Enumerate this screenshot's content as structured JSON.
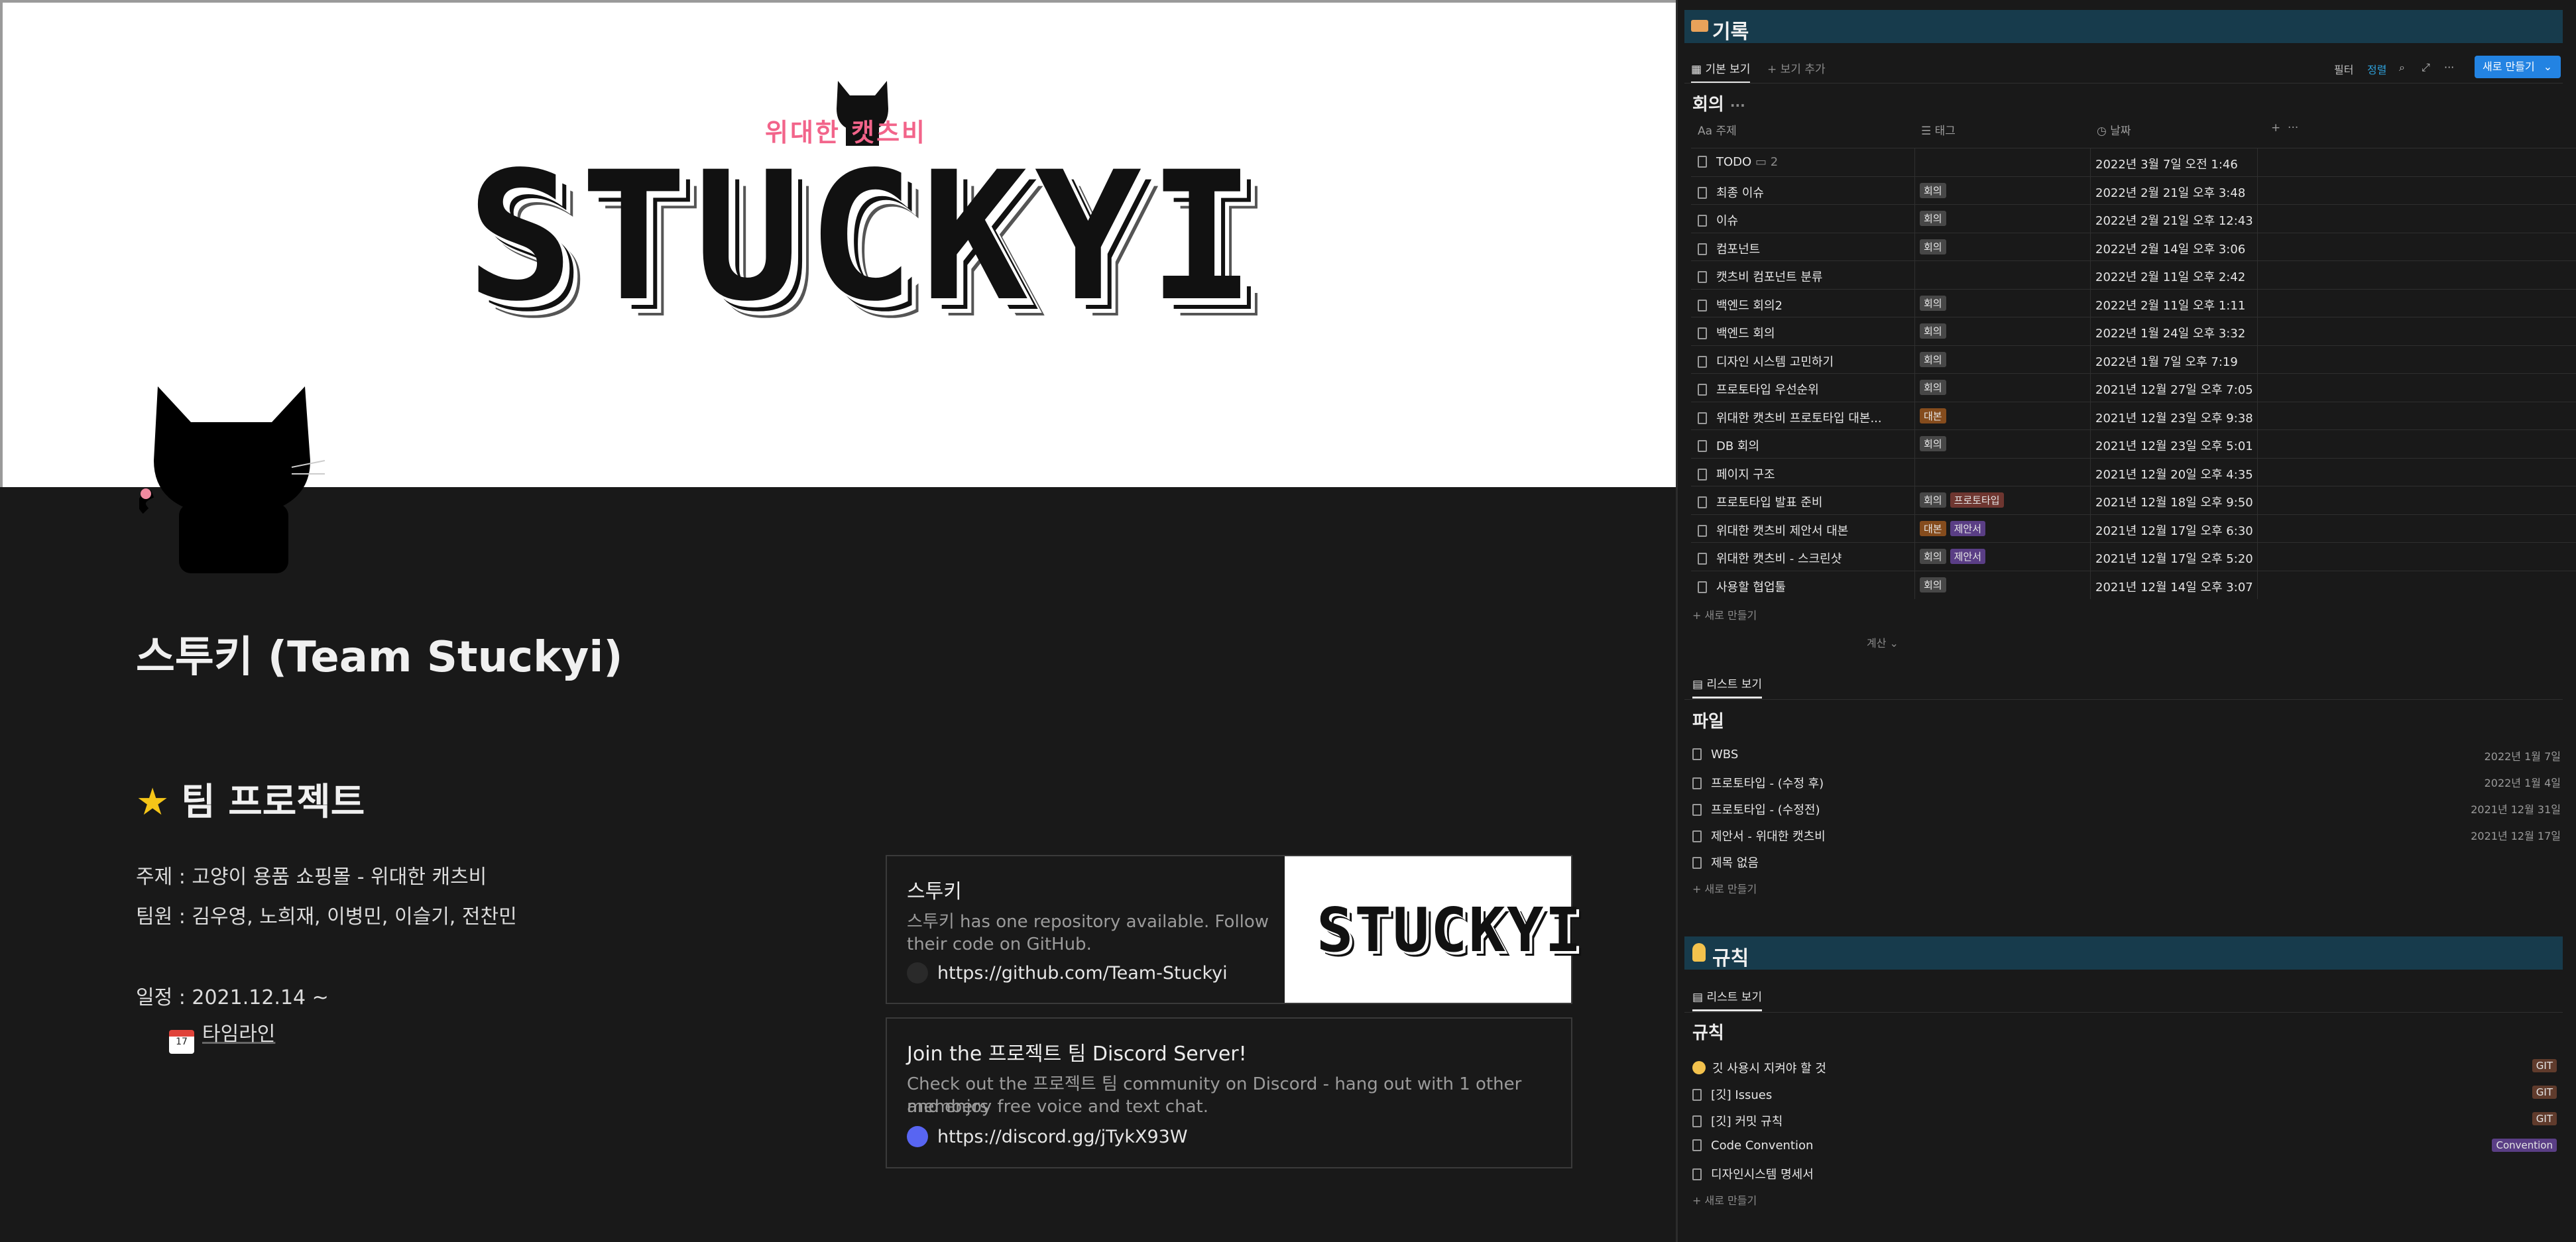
{
  "left": {
    "banner": {
      "logo_small": "위대한 캣츠비",
      "logo_big": "STUCKYI"
    },
    "title": "스투키 (Team Stuckyi)",
    "section_title": "팀 프로젝트",
    "subject": "주제 :  고양이 용품 쇼핑몰 - 위대한 캐츠비",
    "members": "팀원 : 김우영, 노희재, 이병민, 이슬기, 전찬민",
    "schedule": "일정 : 2021.12.14 ~",
    "timeline": "타임라인",
    "github_card": {
      "title": "스투키",
      "desc_line1": "스투키 has one repository available. Follow",
      "desc_line2": "their code on GitHub.",
      "url": "https://github.com/Team-Stuckyi",
      "thumb": "STUCKYI"
    },
    "discord_card": {
      "title": "Join the 프로젝트 팀 Discord Server!",
      "desc_line1": "Check out the 프로젝트 팀 community on Discord - hang out with 1 other members",
      "desc_line2": "and enjoy free voice and text chat.",
      "url": "https://discord.gg/jTykX93W"
    }
  },
  "records": {
    "header": "기록",
    "tabs": {
      "default_view": "기본 보기",
      "add_view": "+ 보기 추가"
    },
    "toolbar": {
      "filter": "필터",
      "sort": "정렬",
      "new": "새로 만들기"
    },
    "db_title": "회의",
    "columns": {
      "subject": "주제",
      "tags": "태그",
      "date": "날짜"
    },
    "rows": [
      {
        "name": "TODO",
        "comments": "2",
        "tags": [],
        "date": "2022년 3월 7일 오전 1:46"
      },
      {
        "name": "최종 이슈",
        "tags": [
          {
            "t": "회의",
            "c": "grey"
          }
        ],
        "date": "2022년 2월 21일 오후 3:48"
      },
      {
        "name": "이슈",
        "tags": [
          {
            "t": "회의",
            "c": "grey"
          }
        ],
        "date": "2022년 2월 21일 오후 12:43"
      },
      {
        "name": "컴포넌트",
        "tags": [
          {
            "t": "회의",
            "c": "grey"
          }
        ],
        "date": "2022년 2월 14일 오후 3:06"
      },
      {
        "name": "캣츠비 컴포넌트 분류",
        "tags": [],
        "date": "2022년 2월 11일 오후 2:42"
      },
      {
        "name": "백엔드 회의2",
        "tags": [
          {
            "t": "회의",
            "c": "grey"
          }
        ],
        "date": "2022년 2월 11일 오후 1:11"
      },
      {
        "name": "백엔드 회의",
        "tags": [
          {
            "t": "회의",
            "c": "grey"
          }
        ],
        "date": "2022년 1월 24일 오후 3:32"
      },
      {
        "name": "디자인 시스템 고민하기",
        "tags": [
          {
            "t": "회의",
            "c": "grey"
          }
        ],
        "date": "2022년 1월 7일 오후 7:19"
      },
      {
        "name": "프로토타입 우선순위",
        "tags": [
          {
            "t": "회의",
            "c": "grey"
          }
        ],
        "date": "2021년 12월 27일 오후 7:05"
      },
      {
        "name": "위대한 캣츠비 프로토타입 대본...",
        "tags": [
          {
            "t": "대본",
            "c": "orange"
          }
        ],
        "date": "2021년 12월 23일 오후 9:38"
      },
      {
        "name": "DB 회의",
        "tags": [
          {
            "t": "회의",
            "c": "grey"
          }
        ],
        "date": "2021년 12월 23일 오후 5:01"
      },
      {
        "name": "페이지 구조",
        "tags": [],
        "date": "2021년 12월 20일 오후 4:35"
      },
      {
        "name": "프로토타입 발표 준비",
        "tags": [
          {
            "t": "회의",
            "c": "grey"
          },
          {
            "t": "프로토타입",
            "c": "red"
          }
        ],
        "date": "2021년 12월 18일 오후 9:50"
      },
      {
        "name": "위대한 캣츠비 제안서 대본",
        "tags": [
          {
            "t": "대본",
            "c": "orange"
          },
          {
            "t": "제안서",
            "c": "purple"
          }
        ],
        "date": "2021년 12월 17일 오후 6:30"
      },
      {
        "name": "위대한 캣츠비 - 스크린샷",
        "tags": [
          {
            "t": "회의",
            "c": "grey"
          },
          {
            "t": "제안서",
            "c": "purple"
          }
        ],
        "date": "2021년 12월 17일 오후 5:20"
      },
      {
        "name": "사용할 협업툴",
        "tags": [
          {
            "t": "회의",
            "c": "grey"
          }
        ],
        "date": "2021년 12월 14일 오후 3:07"
      }
    ],
    "new_row": "+ 새로 만들기",
    "calc": "계산 ⌄"
  },
  "files": {
    "tab": "리스트 보기",
    "db_title": "파일",
    "rows": [
      {
        "name": "WBS",
        "date": "2022년 1월 7일"
      },
      {
        "name": "프로토타입 - (수정 후)",
        "date": "2022년 1월 4일"
      },
      {
        "name": "프로토타입 - (수정전)",
        "date": "2021년 12월 31일"
      },
      {
        "name": "제안서 - 위대한 캣츠비",
        "date": "2021년 12월 17일"
      },
      {
        "name": "제목 없음",
        "date": ""
      }
    ],
    "new_row": "+ 새로 만들기"
  },
  "rules": {
    "header": "규칙",
    "tab": "리스트 보기",
    "db_title": "규칙",
    "rows": [
      {
        "name": "깃 사용시 지켜야 할 것",
        "tag": "GIT",
        "c": "brown",
        "emoji": true
      },
      {
        "name": "[깃] Issues",
        "tag": "GIT",
        "c": "brown"
      },
      {
        "name": "[깃] 커밋 규칙",
        "tag": "GIT",
        "c": "brown"
      },
      {
        "name": "Code Convention",
        "tag": "Convention",
        "c": "purple"
      },
      {
        "name": "디자인시스템 명세서",
        "tag": "",
        "c": ""
      }
    ],
    "new_row": "+ 새로 만들기"
  }
}
